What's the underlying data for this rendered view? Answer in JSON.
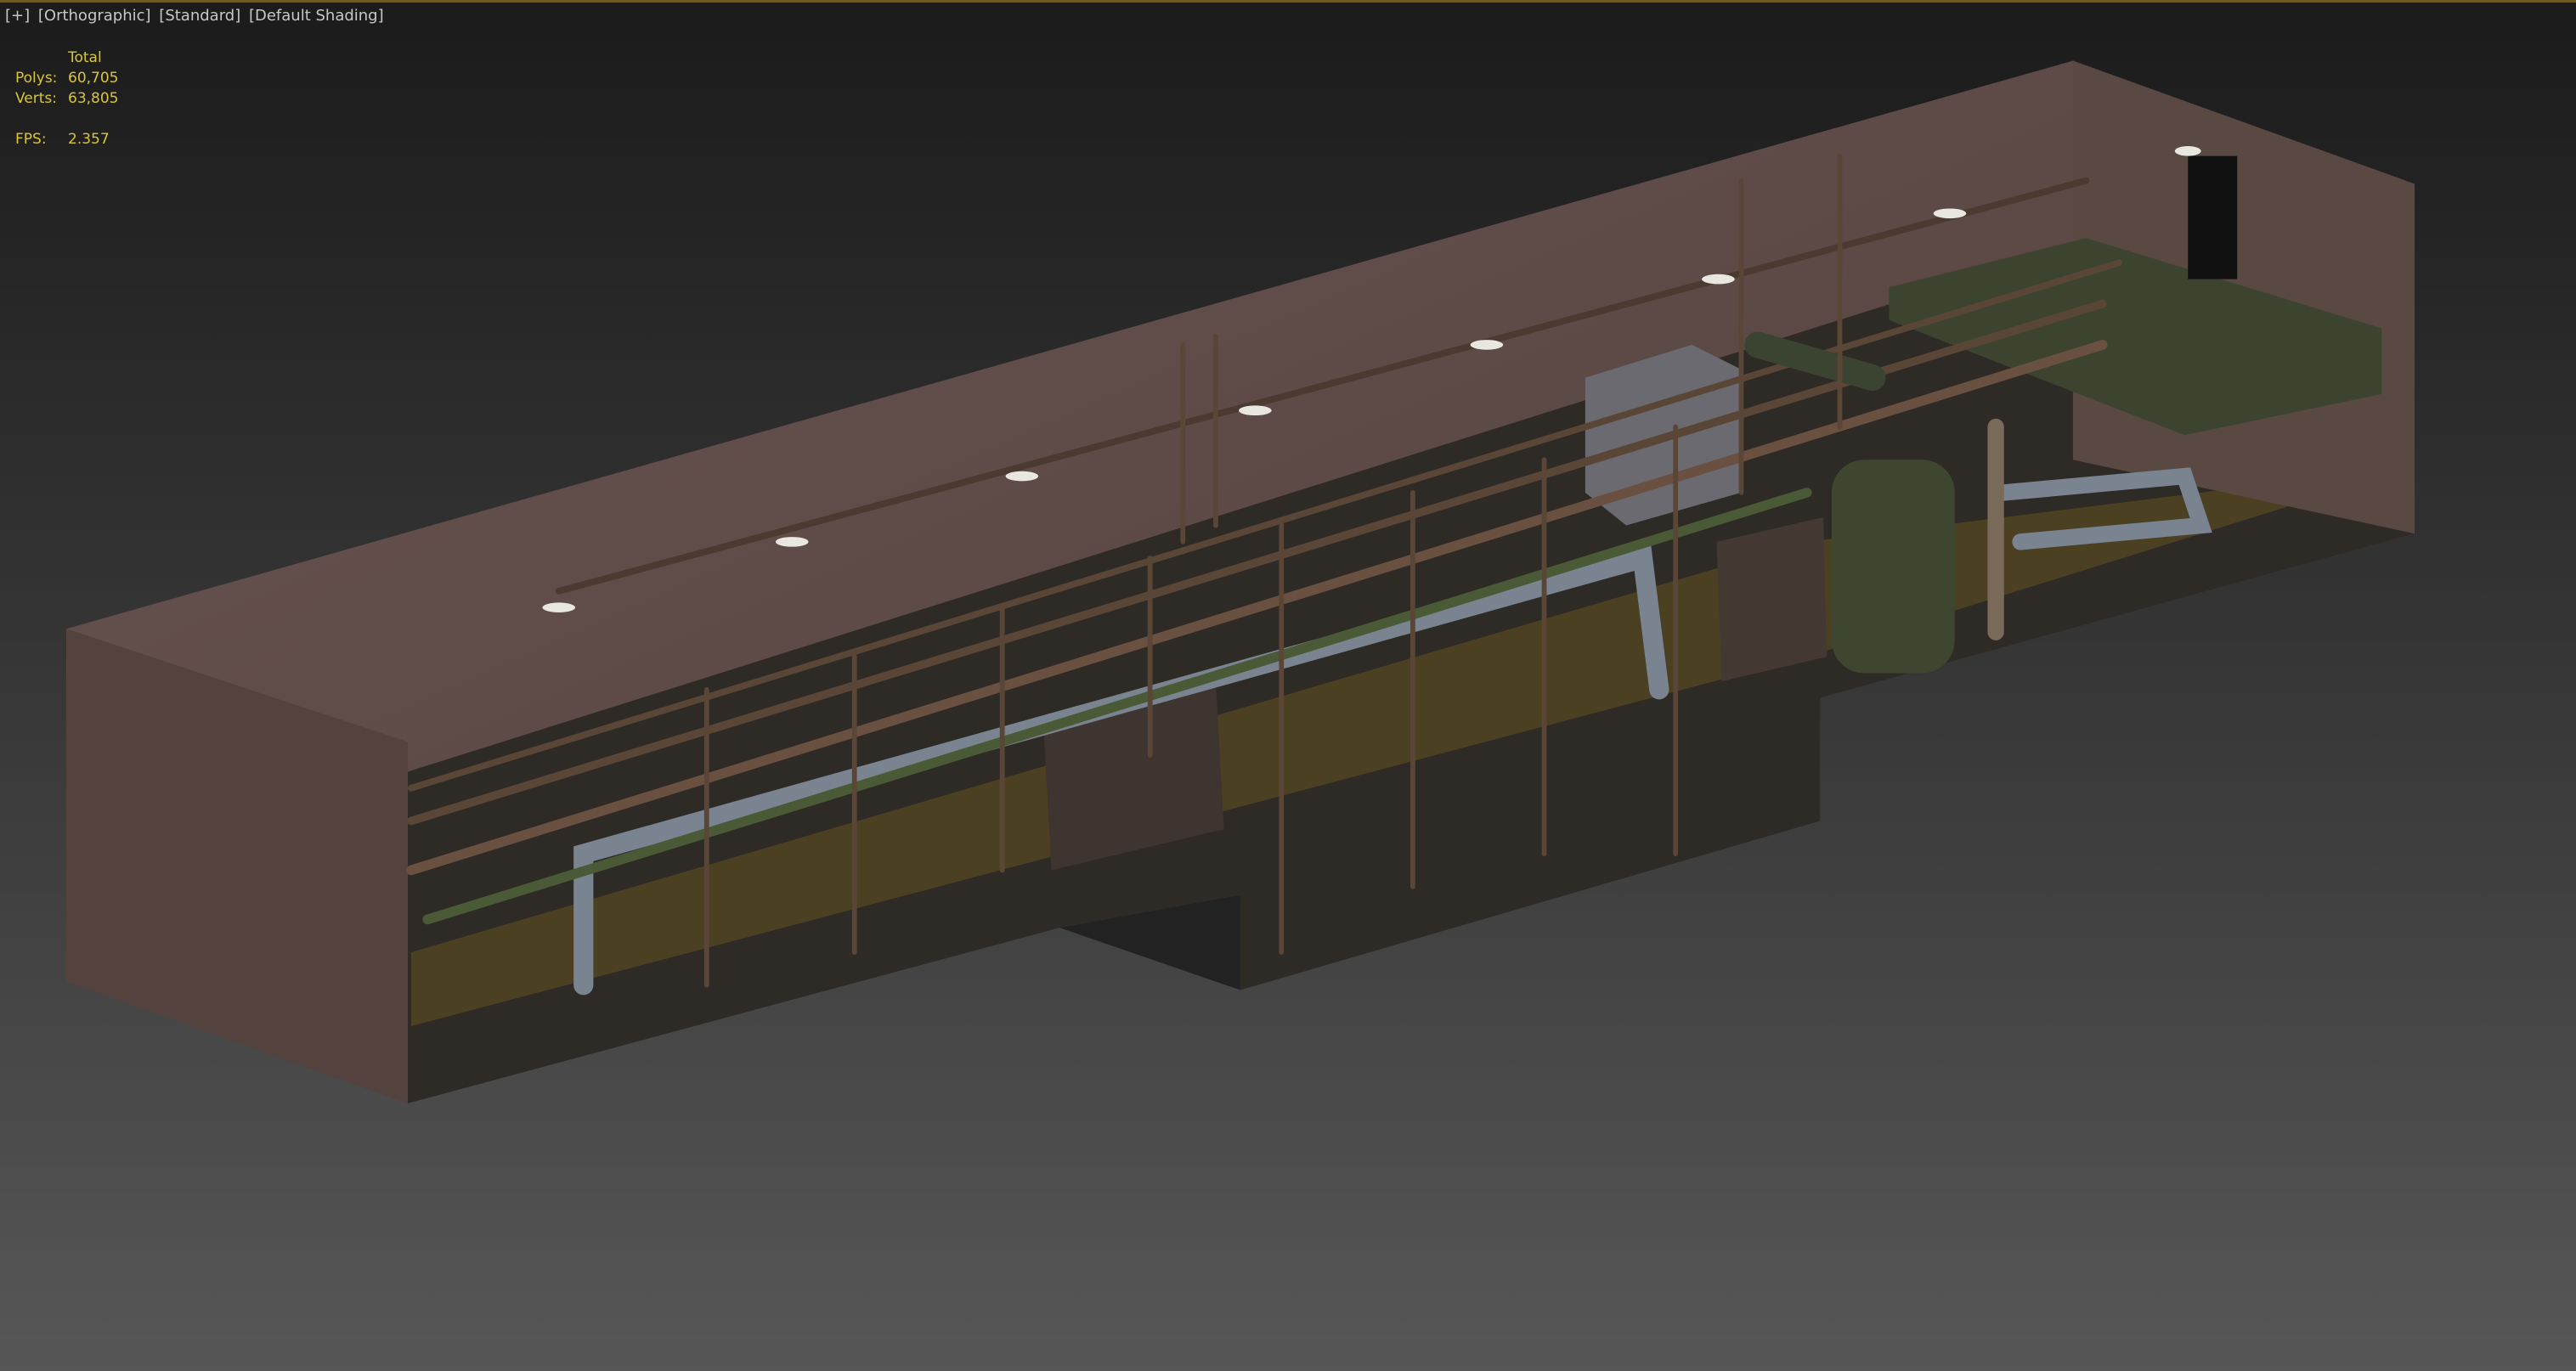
{
  "viewport": {
    "labels": [
      "[+]",
      "[Orthographic]",
      "[Standard]",
      "[Default Shading]"
    ]
  },
  "stats": {
    "header": "Total",
    "polys_label": "Polys:",
    "polys_value": "60,705",
    "verts_label": "Verts:",
    "verts_value": "63,805",
    "fps_label": "FPS:",
    "fps_value": "2.357"
  },
  "colors": {
    "stats_text": "#d8c53a",
    "label_text": "#c8c8c8",
    "wall": "#5e4a44",
    "pipe_rust": "#6a5040",
    "pipe_blue": "#7a8490"
  }
}
